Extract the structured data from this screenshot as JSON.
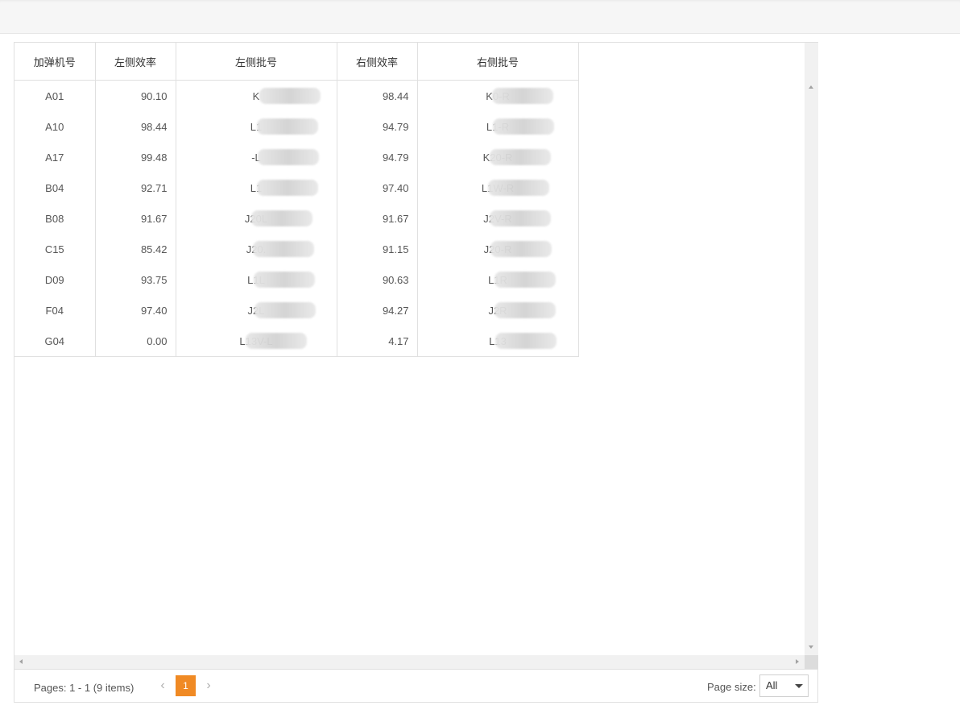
{
  "table": {
    "columns": [
      "加弹机号",
      "左侧效率",
      "左侧批号",
      "右侧效率",
      "右侧批号"
    ],
    "rows": [
      {
        "machine": "A01",
        "left_eff": "90.10",
        "left_batch": "K",
        "right_eff": "98.44",
        "right_batch": "K0-R"
      },
      {
        "machine": "A10",
        "left_eff": "98.44",
        "left_batch": "L1",
        "right_eff": "94.79",
        "right_batch": "L1-R"
      },
      {
        "machine": "A17",
        "left_eff": "99.48",
        "left_batch": "-L",
        "right_eff": "94.79",
        "right_batch": "K20-R"
      },
      {
        "machine": "B04",
        "left_eff": "92.71",
        "left_batch": "L1",
        "right_eff": "97.40",
        "right_batch": "L1W-R"
      },
      {
        "machine": "B08",
        "left_eff": "91.67",
        "left_batch": "J20L",
        "right_eff": "91.67",
        "right_batch": "J2V-R"
      },
      {
        "machine": "C15",
        "left_eff": "85.42",
        "left_batch": "J20.",
        "right_eff": "91.15",
        "right_batch": "J20-R"
      },
      {
        "machine": "D09",
        "left_eff": "93.75",
        "left_batch": "L1L",
        "right_eff": "90.63",
        "right_batch": "L1R"
      },
      {
        "machine": "F04",
        "left_eff": "97.40",
        "left_batch": "J2L",
        "right_eff": "94.27",
        "right_batch": "J2R"
      },
      {
        "machine": "G04",
        "left_eff": "0.00",
        "left_batch": "L13V-L",
        "right_eff": "4.17",
        "right_batch": "L13"
      }
    ]
  },
  "pager": {
    "info": "Pages: 1 - 1 (9 items)",
    "current_page": "1",
    "prev_glyph": "‹",
    "next_glyph": "›",
    "page_size_label": "Page size:",
    "page_size_value": "All"
  }
}
